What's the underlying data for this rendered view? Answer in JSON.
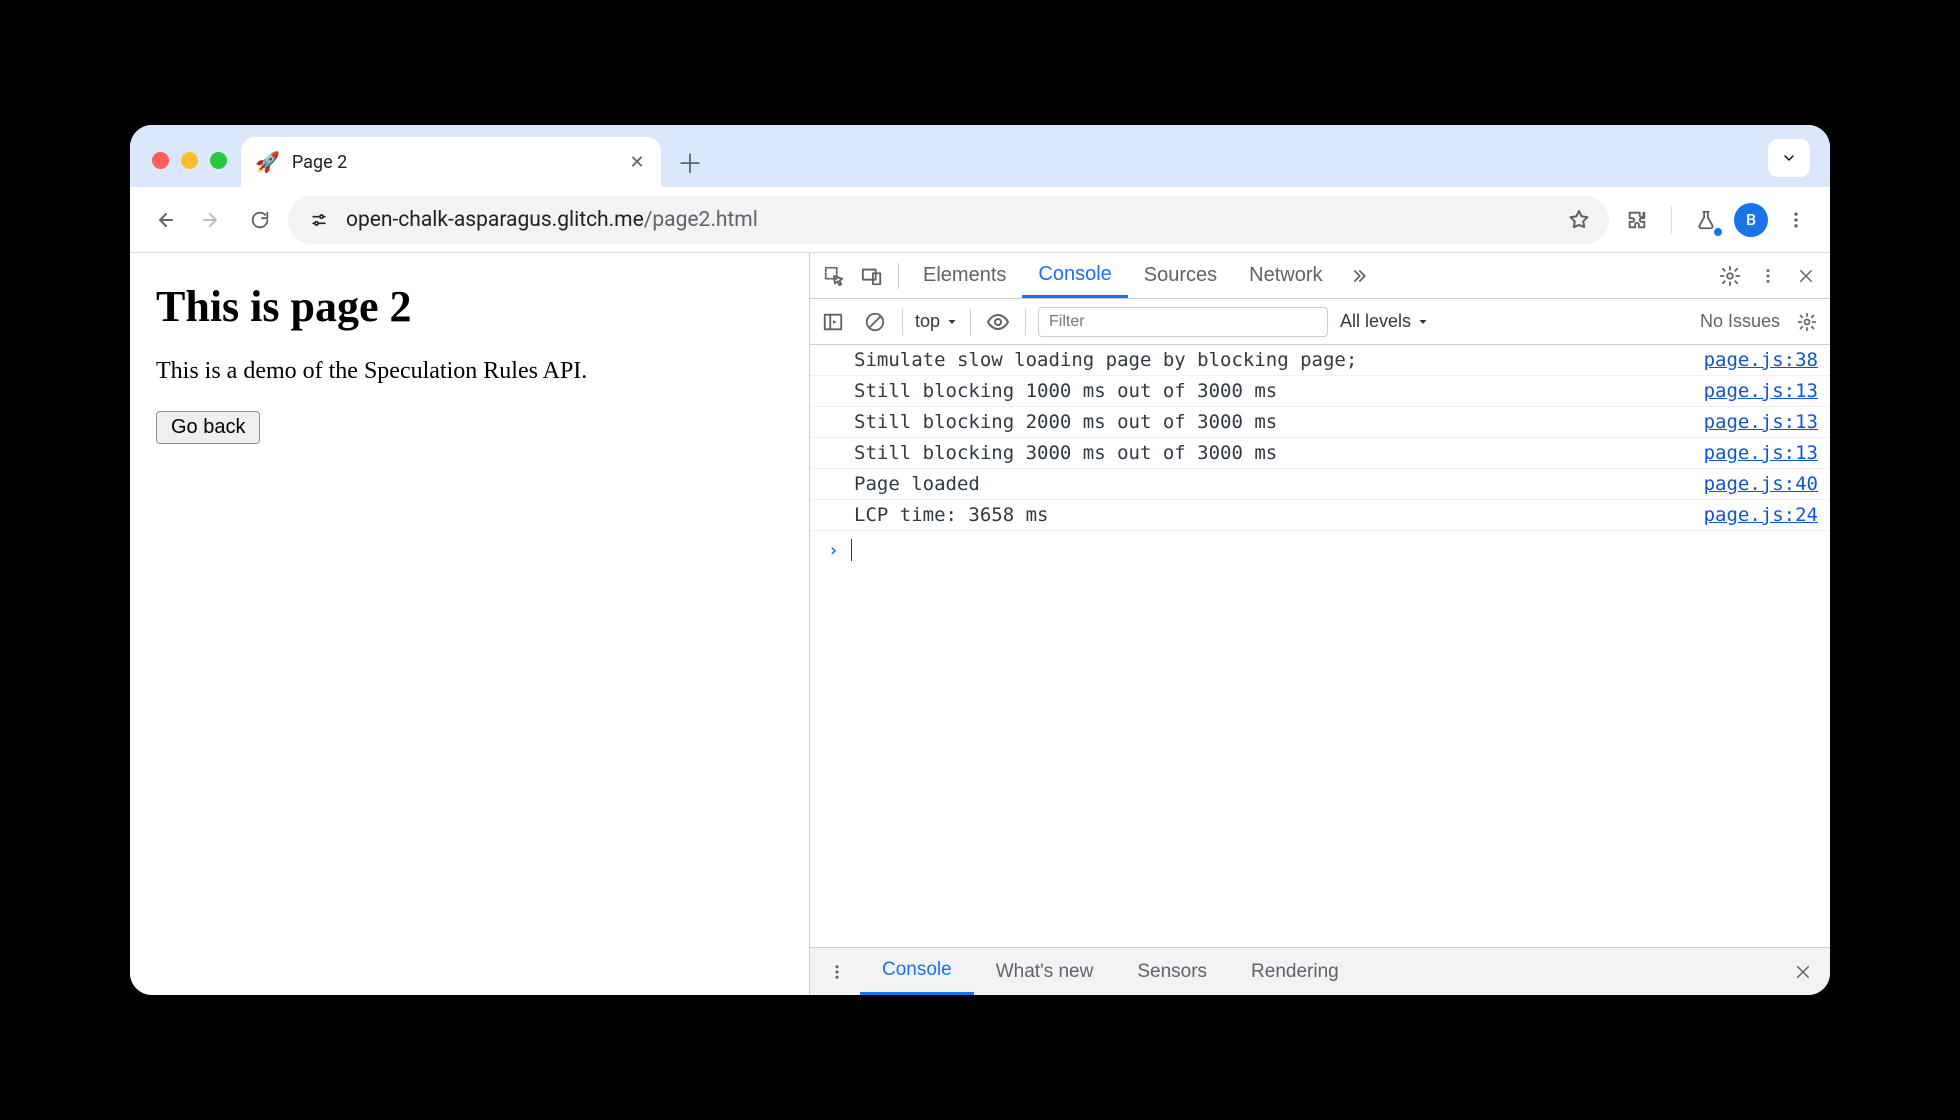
{
  "browser": {
    "tab": {
      "favicon": "🚀",
      "title": "Page 2"
    },
    "url_host": "open-chalk-asparagus.glitch.me",
    "url_path": "/page2.html",
    "avatar_initial": "B"
  },
  "page": {
    "heading": "This is page 2",
    "paragraph": "This is a demo of the Speculation Rules API.",
    "button_label": "Go back"
  },
  "devtools": {
    "tabs": [
      "Elements",
      "Console",
      "Sources",
      "Network"
    ],
    "active_tab": "Console",
    "console_toolbar": {
      "context": "top",
      "filter_placeholder": "Filter",
      "levels": "All levels",
      "issues": "No Issues"
    },
    "logs": [
      {
        "msg": "Simulate slow loading page by blocking page;",
        "src": "page.js:38"
      },
      {
        "msg": "Still blocking 1000 ms out of 3000 ms",
        "src": "page.js:13"
      },
      {
        "msg": "Still blocking 2000 ms out of 3000 ms",
        "src": "page.js:13"
      },
      {
        "msg": "Still blocking 3000 ms out of 3000 ms",
        "src": "page.js:13"
      },
      {
        "msg": "Page loaded",
        "src": "page.js:40"
      },
      {
        "msg": "LCP time: 3658 ms",
        "src": "page.js:24"
      }
    ],
    "drawer_tabs": [
      "Console",
      "What's new",
      "Sensors",
      "Rendering"
    ],
    "drawer_active": "Console"
  }
}
